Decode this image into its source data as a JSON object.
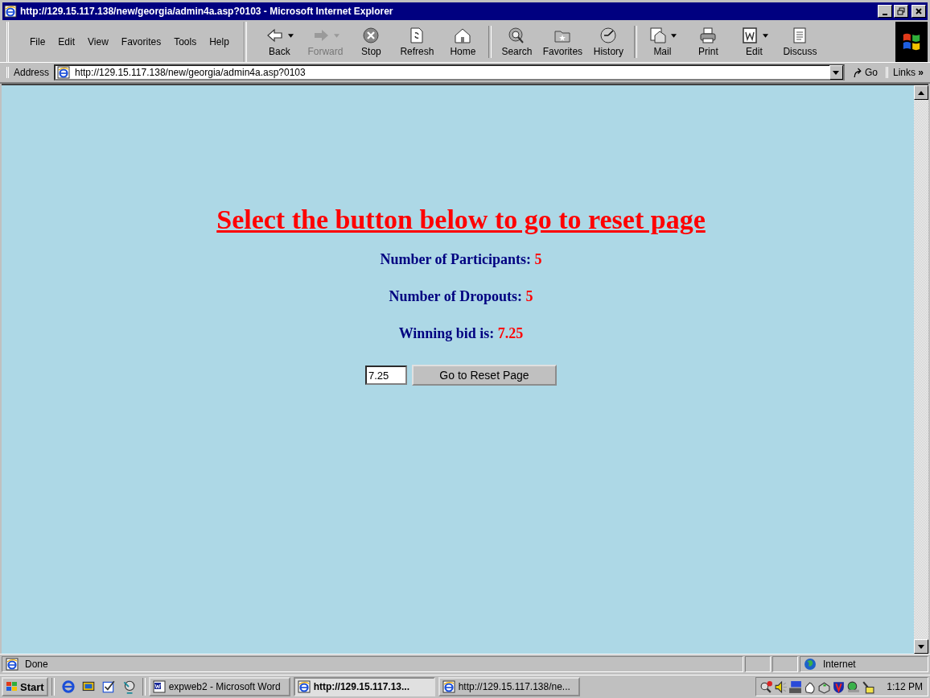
{
  "window": {
    "title": "http://129.15.117.138/new/georgia/admin4a.asp?0103 - Microsoft Internet Explorer"
  },
  "menu": [
    "File",
    "Edit",
    "View",
    "Favorites",
    "Tools",
    "Help"
  ],
  "toolbar_groups": [
    {
      "buttons": [
        {
          "label": "Back",
          "kind": "back",
          "dropdown": true,
          "disabled": false
        },
        {
          "label": "Forward",
          "kind": "forward",
          "dropdown": true,
          "disabled": true
        },
        {
          "label": "Stop",
          "kind": "stop",
          "dropdown": false,
          "disabled": false
        },
        {
          "label": "Refresh",
          "kind": "refresh",
          "dropdown": false,
          "disabled": false
        },
        {
          "label": "Home",
          "kind": "home",
          "dropdown": false,
          "disabled": false
        }
      ]
    },
    {
      "buttons": [
        {
          "label": "Search",
          "kind": "search",
          "dropdown": false,
          "disabled": false
        },
        {
          "label": "Favorites",
          "kind": "favorites",
          "dropdown": false,
          "disabled": false
        },
        {
          "label": "History",
          "kind": "history",
          "dropdown": false,
          "disabled": false
        }
      ]
    },
    {
      "buttons": [
        {
          "label": "Mail",
          "kind": "mail",
          "dropdown": true,
          "disabled": false
        },
        {
          "label": "Print",
          "kind": "print",
          "dropdown": false,
          "disabled": false
        },
        {
          "label": "Edit",
          "kind": "edit",
          "dropdown": true,
          "disabled": false
        },
        {
          "label": "Discuss",
          "kind": "discuss",
          "dropdown": false,
          "disabled": false
        }
      ]
    }
  ],
  "address": {
    "label": "Address",
    "value": "http://129.15.117.138/new/georgia/admin4a.asp?0103",
    "go": "Go",
    "links": "Links",
    "links_chevron": "»"
  },
  "page": {
    "heading": "Select the button below to go to reset page",
    "stats": [
      {
        "label": "Number of Participants:",
        "value": "5"
      },
      {
        "label": "Number of Dropouts:",
        "value": "5"
      },
      {
        "label": "Winning bid is:",
        "value": "7.25"
      }
    ],
    "bid_field": {
      "value": "7.25"
    },
    "button": "Go to Reset Page"
  },
  "status_bar": {
    "text": "Done",
    "zone": "Internet"
  },
  "taskbar": {
    "start": "Start",
    "tasks": [
      {
        "label": "expweb2 - Microsoft Word",
        "kind": "word",
        "selected": false
      },
      {
        "label": "http://129.15.117.13...",
        "kind": "ie",
        "selected": true
      },
      {
        "label": "http://129.15.117.138/ne...",
        "kind": "ie",
        "selected": false
      }
    ],
    "clock": "1:12 PM"
  }
}
